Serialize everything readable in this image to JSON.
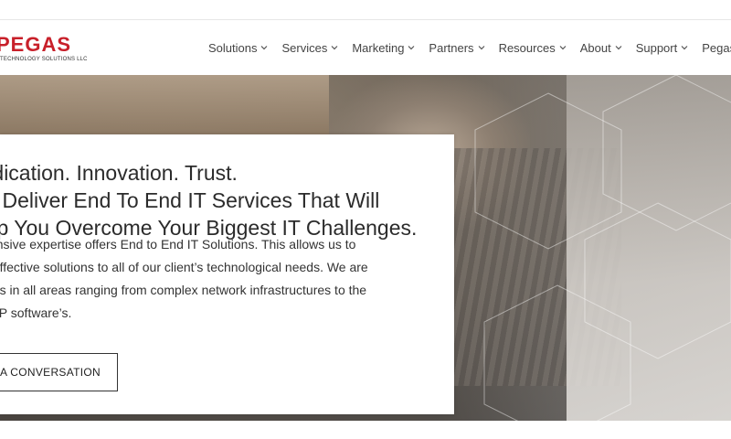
{
  "logo": {
    "wordmark": "PEGAS",
    "tagline": "TECHNOLOGY SOLUTIONS LLC",
    "color": "#c8202a"
  },
  "nav": {
    "items": [
      {
        "label": "Solutions"
      },
      {
        "label": "Services"
      },
      {
        "label": "Marketing"
      },
      {
        "label": "Partners"
      },
      {
        "label": "Resources"
      },
      {
        "label": "About"
      },
      {
        "label": "Support"
      },
      {
        "label": "Pegas"
      }
    ],
    "chevron_icon": "chevron-down-icon"
  },
  "hero": {
    "headline_lines": [
      "Dedication. Innovation. Trust.",
      "We Deliver End To End IT Services That Will",
      "Help You Overcome Your Biggest IT Challenges."
    ],
    "body_lines": [
      "Our extensive expertise offers End to End IT Solutions. This allows us to",
      "provide effective solutions to all of our client’s technological needs. We are",
      "specialists in all areas ranging from complex network infrastructures to the",
      "latest ERP software’s."
    ],
    "cta_label": "START A CONVERSATION"
  }
}
